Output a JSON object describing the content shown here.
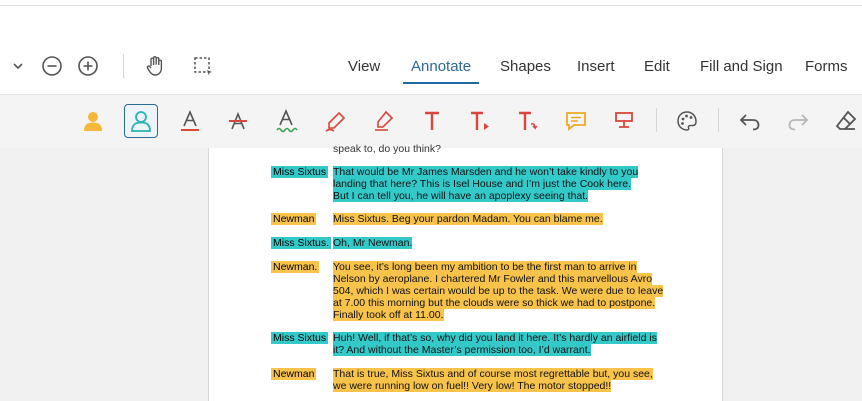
{
  "toolbar": {
    "tabs": [
      "View",
      "Annotate",
      "Shapes",
      "Insert",
      "Edit",
      "Fill and Sign",
      "Forms"
    ],
    "active_tab": "Annotate",
    "accent_color": "#1e6a9e",
    "icons": [
      "chevron-down-icon",
      "zoom-out-icon",
      "zoom-in-icon",
      "hand-tool-icon",
      "selection-tool-icon"
    ]
  },
  "annotate_tools": [
    "highlight-area-icon",
    "highlight-person-icon",
    "underline-text-icon",
    "strikeout-text-icon",
    "squiggly-text-icon",
    "pen-icon",
    "highlighter-icon",
    "add-text-icon",
    "text-callout-icon",
    "text-replace-icon",
    "comment-icon",
    "text-box-icon",
    "color-palette-icon",
    "undo-icon",
    "redo-icon",
    "eraser-icon"
  ],
  "document": {
    "partial_top": "speak to, do you think?",
    "entries": [
      {
        "speaker": "Miss Sixtus",
        "color": "cyan",
        "lines": [
          "That would be Mr James Marsden and he won’t take kindly to you",
          "landing that here? This is Isel House and I’m just the Cook here.",
          "But I can tell you, he will have an apoplexy seeing that."
        ]
      },
      {
        "speaker": "Newman",
        "color": "yellow",
        "lines": [
          "Miss Sixtus.  Beg your pardon Madam. You can blame me."
        ]
      },
      {
        "speaker": "Miss Sixtus.",
        "color": "cyan",
        "lines": [
          "Oh, Mr Newman."
        ]
      },
      {
        "speaker": "Newman.",
        "color": "yellow",
        "lines": [
          "You see, it’s long been my ambition to be the first man to arrive in",
          "Nelson by aeroplane.  I chartered Mr Fowler and this marvellous Avro",
          "504, which I was certain would be up to the task. We were due to leave",
          "at 7.00 this morning but the clouds were so thick we had to postpone.",
          "Finally took off at 11.00."
        ]
      },
      {
        "speaker": "Miss Sixtus",
        "color": "cyan",
        "lines": [
          "Huh!  Well, if that’s so, why did you land it here. It’s hardly an airfield is",
          "it? And without the Master’s permission too, I’d warrant."
        ]
      },
      {
        "speaker": "Newman",
        "color": "yellow",
        "lines": [
          "That is true, Miss Sixtus and of course most regrettable but, you see,",
          "we were running low on fuel!! Very low! The motor stopped!!"
        ]
      }
    ]
  }
}
